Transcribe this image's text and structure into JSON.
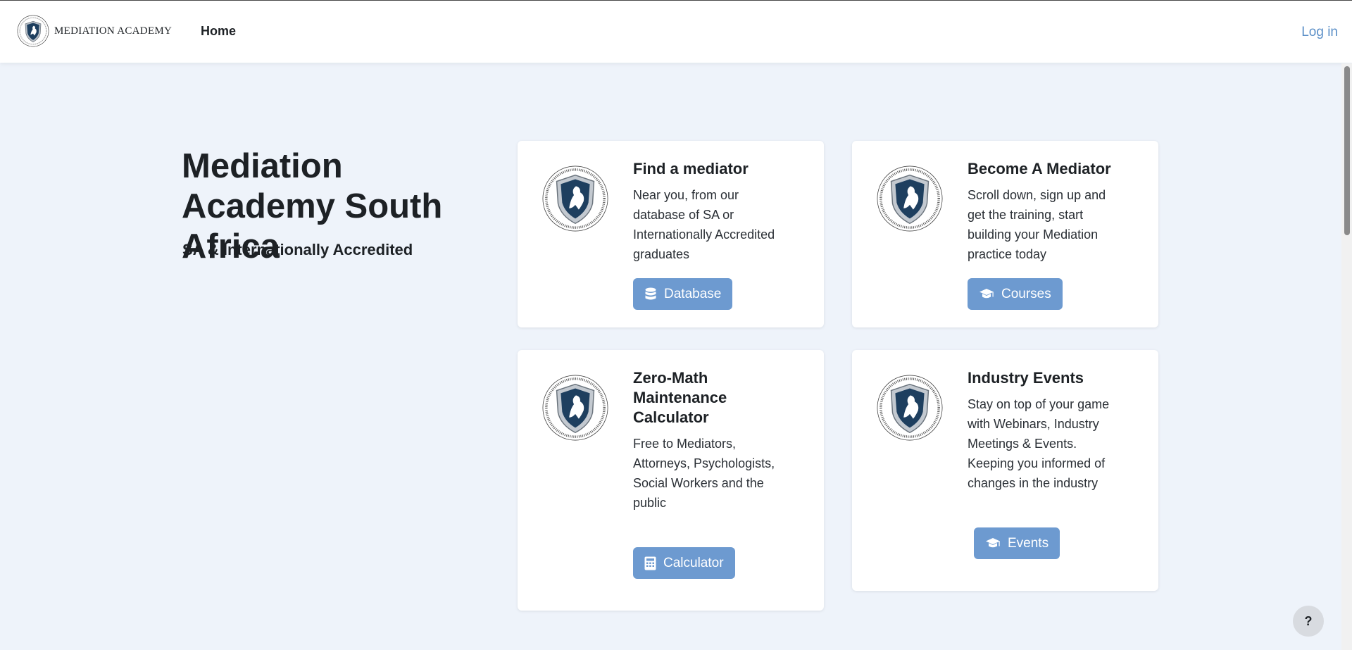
{
  "navbar": {
    "brand_text": "MEDIATION ACADEMY",
    "home_label": "Home",
    "login_label": "Log in"
  },
  "hero": {
    "title": "Mediation Academy South Africa",
    "subtitle": "SA & Internationally Accredited"
  },
  "cards": [
    {
      "title": "Find a mediator",
      "text": "Near you, from our database of SA or Internationally Accredited graduates",
      "button_label": "Database",
      "button_icon": "database-icon"
    },
    {
      "title": "Become A Mediator",
      "text": "Scroll down, sign up and get the training, start building your Mediation practice today",
      "button_label": "Courses",
      "button_icon": "graduation-cap-icon"
    },
    {
      "title": "Zero-Math Maintenance Calculator",
      "text": "Free to Mediators, Attorneys, Psychologists, Social Workers and the public",
      "button_label": "Calculator",
      "button_icon": "calculator-icon"
    },
    {
      "title": "Industry Events",
      "text": "Stay on top of your game with Webinars, Industry Meetings & Events. Keeping you informed of changes in the industry",
      "button_label": "Events",
      "button_icon": "graduation-cap-icon"
    }
  ],
  "help": {
    "label": "?"
  },
  "colors": {
    "page_bg": "#eef3fa",
    "button_bg": "#6d9ad0",
    "link": "#5b8fc7",
    "seal_shield": "#1e3f5f"
  }
}
